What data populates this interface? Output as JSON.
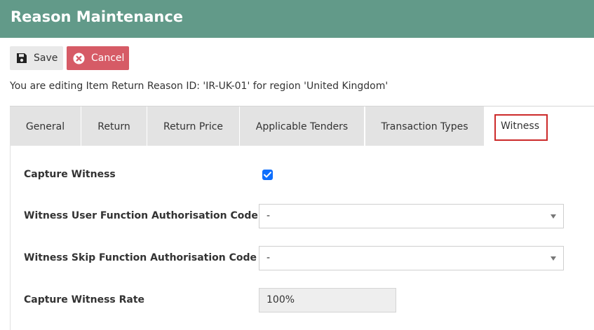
{
  "header": {
    "title": "Reason Maintenance"
  },
  "toolbar": {
    "save_label": "Save",
    "cancel_label": "Cancel"
  },
  "info_text": "You are editing Item Return Reason ID: 'IR-UK-01' for region 'United Kingdom'",
  "tabs": [
    {
      "label": "General"
    },
    {
      "label": "Return"
    },
    {
      "label": "Return Price"
    },
    {
      "label": "Applicable Tenders"
    },
    {
      "label": "Transaction Types"
    },
    {
      "label": "Witness",
      "active": true
    }
  ],
  "form": {
    "capture_witness": {
      "label": "Capture Witness",
      "checked": true
    },
    "user_function_code": {
      "label": "Witness User Function Authorisation Code",
      "value": "-"
    },
    "skip_function_code": {
      "label": "Witness Skip Function Authorisation Code",
      "value": "-"
    },
    "capture_rate": {
      "label": "Capture Witness Rate",
      "value": "100%"
    }
  },
  "colors": {
    "header_bg": "#629a89",
    "cancel_bg": "#d65b66",
    "checkbox": "#0d6efd",
    "highlight": "#cc2a2a"
  }
}
